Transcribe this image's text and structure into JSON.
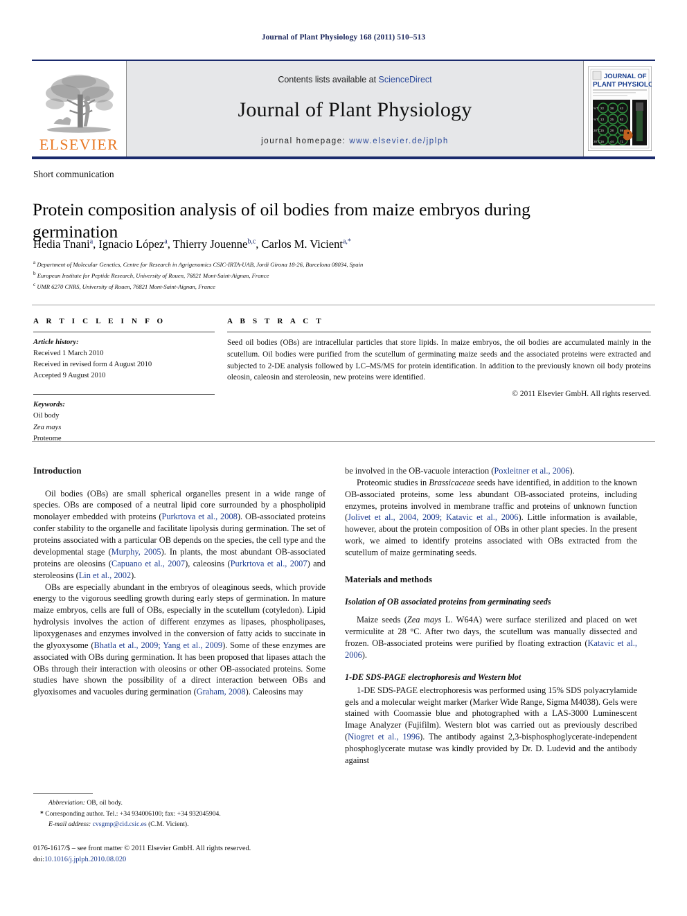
{
  "running_head": "Journal of Plant Physiology 168 (2011) 510–513",
  "masthead": {
    "publisher_name": "ELSEVIER",
    "contents_prefix": "Contents lists available at ",
    "contents_link": "ScienceDirect",
    "journal_name": "Journal of Plant Physiology",
    "homepage_prefix": "journal homepage: ",
    "homepage_url": "www.elsevier.de/jplph",
    "cover_title_line1": "JOURNAL OF",
    "cover_title_line2": "PLANT PHYSIOLOGY",
    "colors": {
      "elsevier_orange": "#e87722",
      "navy_rule": "#1a2a6c",
      "link_blue": "#2c4a9a",
      "mast_grey": "#e6e7e9"
    }
  },
  "article": {
    "category": "Short communication",
    "title": "Protein composition analysis of oil bodies from maize embryos during germination",
    "authors_html": "Hedia Tnani<sup>a</sup>, Ignacio López<sup>a</sup>, Thierry Jouenne<sup>b,c</sup>, Carlos M. Vicient<sup>a,*</sup>",
    "affiliations": [
      {
        "marker": "a",
        "text": "Department of Molecular Genetics, Centre for Research in Agrigenomics CSIC-IRTA-UAB, Jordi Girona 18-26, Barcelona 08034, Spain"
      },
      {
        "marker": "b",
        "text": "European Institute for Peptide Research, University of Rouen, 76821 Mont-Saint-Aignan, France"
      },
      {
        "marker": "c",
        "text": "UMR 6270 CNRS, University of Rouen, 76821 Mont-Saint-Aignan, France"
      }
    ]
  },
  "article_info": {
    "heading": "A R T I C L E   I N F O",
    "history_label": "Article history:",
    "history": [
      "Received 1 March 2010",
      "Received in revised form 4 August 2010",
      "Accepted 9 August 2010"
    ],
    "keywords_label": "Keywords:",
    "keywords": [
      "Oil body",
      "Zea mays",
      "Proteome"
    ]
  },
  "abstract": {
    "heading": "A B S T R A C T",
    "text": "Seed oil bodies (OBs) are intracellular particles that store lipids. In maize embryos, the oil bodies are accumulated mainly in the scutellum. Oil bodies were purified from the scutellum of germinating maize seeds and the associated proteins were extracted and subjected to 2-DE analysis followed by LC–MS/MS for protein identification. In addition to the previously known oil body proteins oleosin, caleosin and steroleosin, new proteins were identified.",
    "copyright": "© 2011 Elsevier GmbH. All rights reserved."
  },
  "body": {
    "left": {
      "intro_heading": "Introduction",
      "p1_a": "Oil bodies (OBs) are small spherical organelles present in a wide range of species. OBs are composed of a neutral lipid core surrounded by a phospholipid monolayer embedded with proteins (",
      "p1_ref1": "Purkrtova et al., 2008",
      "p1_b": "). OB-associated proteins confer stability to the organelle and facilitate lipolysis during germination. The set of proteins associated with a particular OB depends on the species, the cell type and the developmental stage (",
      "p1_ref2": "Murphy, 2005",
      "p1_c": "). In plants, the most abundant OB-associated proteins are oleosins (",
      "p1_ref3": "Capuano et al., 2007",
      "p1_d": "), caleosins (",
      "p1_ref4": "Purkrtova et al., 2007",
      "p1_e": ") and steroleosins (",
      "p1_ref5": "Lin et al., 2002",
      "p1_f": ").",
      "p2_a": "OBs are especially abundant in the embryos of oleaginous seeds, which provide energy to the vigorous seedling growth during early steps of germination. In mature maize embryos, cells are full of OBs, especially in the scutellum (cotyledon). Lipid hydrolysis involves the action of different enzymes as lipases, phospholipases, lipoxygenases and enzymes involved in the conversion of fatty acids to succinate in the glyoxysome (",
      "p2_ref1": "Bhatla et al., 2009; Yang et al., 2009",
      "p2_b": "). Some of these enzymes are associated with OBs during germination. It has been proposed that lipases attach the OBs through their interaction with oleosins or other OB-associated proteins. Some studies have shown the possibility of a direct interaction between OBs and glyoxisomes and vacuoles during germination (",
      "p2_ref2": "Graham, 2008",
      "p2_c": "). Caleosins may"
    },
    "right": {
      "p1_a": "be involved in the OB-vacuole interaction (",
      "p1_ref1": "Poxleitner et al., 2006",
      "p1_b": ").",
      "p2_a": "Proteomic studies in ",
      "p2_ital": "Brassicaceae",
      "p2_b": " seeds have identified, in addition to the known OB-associated proteins, some less abundant OB-associated proteins, including enzymes, proteins involved in membrane traffic and proteins of unknown function (",
      "p2_ref1": "Jolivet et al., 2004, 2009; Katavic et al., 2006",
      "p2_c": "). Little information is available, however, about the protein composition of OBs in other plant species. In the present work, we aimed to identify proteins associated with OBs extracted from the scutellum of maize germinating seeds.",
      "methods_heading": "Materials and methods",
      "sub1_heading": "Isolation of OB associated proteins from germinating seeds",
      "sub1_a": "Maize seeds (",
      "sub1_ital": "Zea mays",
      "sub1_b": " L. W64A) were surface sterilized and placed on wet vermiculite at 28 °C. After two days, the scutellum was manually dissected and frozen. OB-associated proteins were purified by floating extraction (",
      "sub1_ref": "Katavic et al., 2006",
      "sub1_c": ").",
      "sub2_heading": "1-DE SDS-PAGE electrophoresis and Western blot",
      "sub2_a": "1-DE SDS-PAGE electrophoresis was performed using 15% SDS polyacrylamide gels and a molecular weight marker (Marker Wide Range, Sigma M4038). Gels were stained with Coomassie blue and photographed with a LAS-3000 Luminescent Image Analyzer (Fujifilm). Western blot was carried out as previously described (",
      "sub2_ref": "Niogret et al., 1996",
      "sub2_b": "). The antibody against 2,3-bisphosphoglycerate-independent phosphoglycerate mutase was kindly provided by Dr. D. Ludevid and the antibody against"
    }
  },
  "footnotes": {
    "abbrev_label": "Abbreviation:",
    "abbrev_text": "OB, oil body.",
    "corresponding_marker": "*",
    "corresponding_text": "Corresponding author. Tel.: +34 934006100; fax: +34 932045904.",
    "email_label": "E-mail address:",
    "email": "cvsgmp@cid.csic.es",
    "email_suffix": "(C.M. Vicient).",
    "imprint_line": "0176-1617/$ – see front matter © 2011 Elsevier GmbH. All rights reserved.",
    "doi_label": "doi:",
    "doi": "10.1016/j.jplph.2010.08.020"
  }
}
